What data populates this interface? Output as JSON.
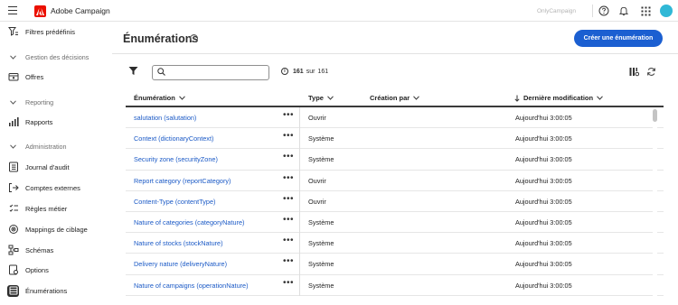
{
  "topbar": {
    "app_name": "Adobe Campaign",
    "org_name": "OnlyCampaign"
  },
  "sidebar": {
    "items": [
      {
        "label": "Filtres prédéfinis",
        "icon": "filter-list-icon"
      },
      {
        "section": "Gestion des décisions"
      },
      {
        "label": "Offres",
        "icon": "offers-icon"
      },
      {
        "section": "Reporting"
      },
      {
        "label": "Rapports",
        "icon": "chart-icon"
      },
      {
        "section": "Administration"
      },
      {
        "label": "Journal d'audit",
        "icon": "audit-log-icon"
      },
      {
        "label": "Comptes externes",
        "icon": "external-accounts-icon"
      },
      {
        "label": "Règles métier",
        "icon": "business-rules-icon"
      },
      {
        "label": "Mappings de ciblage",
        "icon": "target-mapping-icon"
      },
      {
        "label": "Schémas",
        "icon": "schema-icon"
      },
      {
        "label": "Options",
        "icon": "options-icon"
      },
      {
        "label": "Énumérations",
        "icon": "enumerations-icon",
        "active": true
      }
    ]
  },
  "main": {
    "title": "Énumérations",
    "create_button": "Créer une énumération",
    "search_placeholder": "",
    "count": "161",
    "count_sep": "sur",
    "count_total": "161",
    "columns": {
      "name": "Énumération",
      "type": "Type",
      "created_by": "Création par",
      "modified": "Dernière modification"
    },
    "rows": [
      {
        "name": "salutation (salutation)",
        "more": "•••",
        "type": "Ouvrir",
        "modified": "Aujourd'hui 3:00:05"
      },
      {
        "name": "Context (dictionaryContext)",
        "more": "•••",
        "type": "Système",
        "modified": "Aujourd'hui 3:00:05"
      },
      {
        "name": "Security zone (securityZone)",
        "more": "•••",
        "type": "Système",
        "modified": "Aujourd'hui 3:00:05"
      },
      {
        "name": "Report category (reportCategory)",
        "more": "•••",
        "type": "Ouvrir",
        "modified": "Aujourd'hui 3:00:05"
      },
      {
        "name": "Content-Type (contentType)",
        "more": "•••",
        "type": "Ouvrir",
        "modified": "Aujourd'hui 3:00:05"
      },
      {
        "name": "Nature of categories (categoryNature)",
        "more": "•••",
        "type": "Système",
        "modified": "Aujourd'hui 3:00:05"
      },
      {
        "name": "Nature of stocks (stockNature)",
        "more": "•••",
        "type": "Système",
        "modified": "Aujourd'hui 3:00:05"
      },
      {
        "name": "Delivery nature (deliveryNature)",
        "more": "•••",
        "type": "Système",
        "modified": "Aujourd'hui 3:00:05"
      },
      {
        "name": "Nature of campaigns (operationNature)",
        "more": "•••",
        "type": "Système",
        "modified": "Aujourd'hui 3:00:05"
      }
    ]
  },
  "colors": {
    "accent": "#1b5fd1",
    "link": "#1a59c6",
    "adobe_red": "#eb1000",
    "avatar": "#30b8d6"
  }
}
